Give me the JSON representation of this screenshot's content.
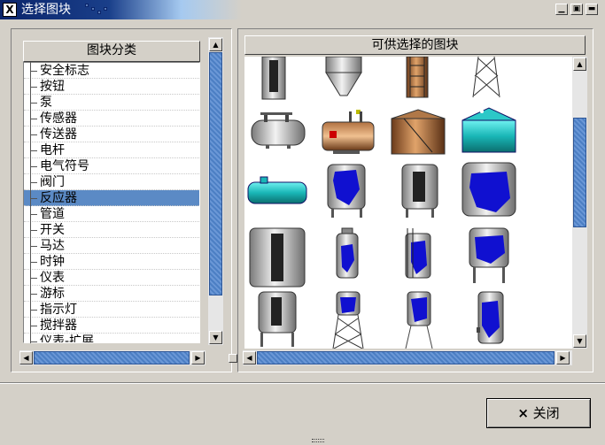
{
  "window": {
    "title": "选择图块",
    "app_icon": "X"
  },
  "left": {
    "header": "图块分类",
    "items": [
      "安全标志",
      "按钮",
      "泵",
      "传感器",
      "传送器",
      "电杆",
      "电气符号",
      "阀门",
      "反应器",
      "管道",
      "开关",
      "马达",
      "时钟",
      "仪表",
      "游标",
      "指示灯",
      "搅拌器",
      "仪表-扩展"
    ],
    "selected_index": 8
  },
  "right": {
    "header": "可供选择的图块",
    "vscroll_position": 0.3
  },
  "footer": {
    "close_label": "关闭",
    "close_icon": "×"
  },
  "colors": {
    "selection": "#5b8ac5",
    "scroll_thumb": "#4c7fc4",
    "title_start": "#0a246a"
  }
}
